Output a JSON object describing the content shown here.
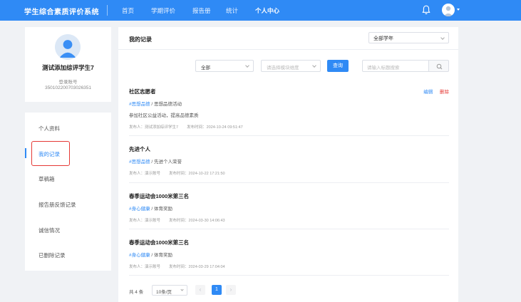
{
  "app": {
    "title": "学生综合素质评价系统",
    "nav": [
      "首页",
      "学期评价",
      "报告册",
      "统计",
      "个人中心"
    ],
    "active_nav": "个人中心"
  },
  "profile": {
    "name": "测试添加综评学生7",
    "account_label": "登录账号",
    "account_number": "350102200703026351"
  },
  "sidebar": {
    "items": [
      {
        "label": "个人资料"
      },
      {
        "label": "我的记录"
      },
      {
        "label": "草稿箱"
      },
      {
        "label": "报告册反馈记录"
      },
      {
        "label": "诚信情况"
      },
      {
        "label": "已删除记录"
      }
    ],
    "active": "我的记录"
  },
  "main": {
    "title": "我的记录",
    "year_select": "全部学年",
    "filter": {
      "all": "全部",
      "module_placeholder": "请选择模块维度",
      "query_button": "查询",
      "search_placeholder": "请输入标题搜索"
    },
    "records": [
      {
        "title": "社区志愿者",
        "category_tag": "#思想品德",
        "category_rest": " / 思想品德活动",
        "description": "参加社区公益活动，提高品德素质",
        "publisher_label": "发布人：",
        "publisher": "测试添加综评学生7",
        "time_label": "发布时间：",
        "time": "2024-10-24 09:51:47",
        "edit": "编辑",
        "delete": "删除"
      },
      {
        "title": "先进个人",
        "category_tag": "#思想品德",
        "category_rest": " / 先进个人荣誉",
        "publisher_label": "发布人：",
        "publisher": "演示账号",
        "time_label": "发布时间：",
        "time": "2024-10-22 17:21:50"
      },
      {
        "title": "春季运动会1000米第三名",
        "category_tag": "#身心健康",
        "category_rest": " / 体育奖励",
        "publisher_label": "发布人：",
        "publisher": "演示账号",
        "time_label": "发布时间：",
        "time": "2024-03-30 14:06:43"
      },
      {
        "title": "春季运动会1000米第三名",
        "category_tag": "#身心健康",
        "category_rest": " / 体育奖励",
        "publisher_label": "发布人：",
        "publisher": "演示账号",
        "time_label": "发布时间：",
        "time": "2024-03-29 17:04:04"
      }
    ],
    "pagination": {
      "total": "共 4 条",
      "page_size": "10条/页",
      "prev": "‹",
      "current": "1",
      "next": "›"
    }
  },
  "colors": {
    "primary": "#2f8af5",
    "danger": "#e53935"
  },
  "icons": {
    "notification": "bell-icon",
    "user": "user-avatar-icon",
    "search": "search-icon"
  }
}
